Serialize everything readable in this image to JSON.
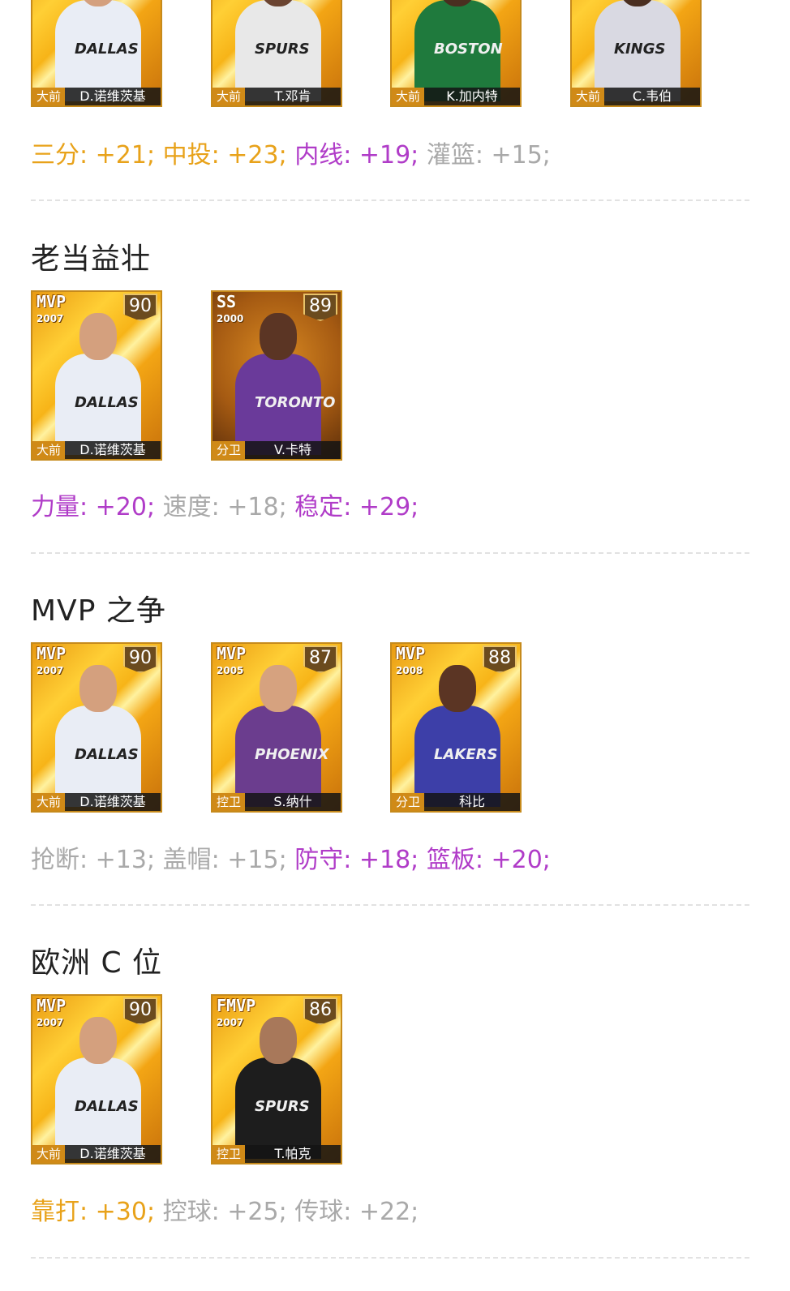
{
  "colors": {
    "gold": "#e8a21a",
    "purple": "#b03cc8",
    "gray": "#a9a9a9"
  },
  "sections": [
    {
      "title": "",
      "cards": [
        {
          "badge": "",
          "year": "",
          "rating": "",
          "pos": "大前",
          "name": "D.诺维茨基",
          "jersey": "DALLAS",
          "jersey_color": "#e9edf5",
          "skin": "#d4a07e"
        },
        {
          "badge": "",
          "year": "",
          "rating": "",
          "pos": "大前",
          "name": "T.邓肯",
          "jersey": "SPURS",
          "jersey_color": "#e8e8e8",
          "skin": "#6b4431"
        },
        {
          "badge": "",
          "year": "",
          "rating": "",
          "pos": "大前",
          "name": "K.加内特",
          "jersey": "BOSTON",
          "jersey_color": "#1f7a3d",
          "skin": "#4a2e20"
        },
        {
          "badge": "",
          "year": "",
          "rating": "",
          "pos": "大前",
          "name": "C.韦伯",
          "jersey": "KINGS",
          "jersey_color": "#d9d9e2",
          "skin": "#4a2e20"
        }
      ],
      "stats": [
        {
          "text": "三分: +21;",
          "color": "#e8a21a"
        },
        {
          "text": "中投: +23;",
          "color": "#e8a21a"
        },
        {
          "text": "内线: +19;",
          "color": "#b03cc8"
        },
        {
          "text": "灌篮: +15;",
          "color": "#a9a9a9"
        }
      ]
    },
    {
      "title": "老当益壮",
      "cards": [
        {
          "badge": "MVP",
          "year": "2007",
          "rating": "90",
          "pos": "大前",
          "name": "D.诺维茨基",
          "jersey": "DALLAS",
          "jersey_color": "#e9edf5",
          "skin": "#d4a07e"
        },
        {
          "badge": "SS",
          "year": "2000",
          "rating": "89",
          "pos": "分卫",
          "name": "V.卡特",
          "jersey": "TORONTO",
          "jersey_color": "#6a3a9a",
          "skin": "#5b3524",
          "dark": true
        }
      ],
      "stats": [
        {
          "text": "力量: +20;",
          "color": "#b03cc8"
        },
        {
          "text": "速度: +18;",
          "color": "#a9a9a9"
        },
        {
          "text": "稳定: +29;",
          "color": "#b03cc8"
        }
      ]
    },
    {
      "title": "MVP 之争",
      "cards": [
        {
          "badge": "MVP",
          "year": "2007",
          "rating": "90",
          "pos": "大前",
          "name": "D.诺维茨基",
          "jersey": "DALLAS",
          "jersey_color": "#e9edf5",
          "skin": "#d4a07e"
        },
        {
          "badge": "MVP",
          "year": "2005",
          "rating": "87",
          "pos": "控卫",
          "name": "S.纳什",
          "jersey": "PHOENIX",
          "jersey_color": "#6b3d8e",
          "skin": "#d6a27f"
        },
        {
          "badge": "MVP",
          "year": "2008",
          "rating": "88",
          "pos": "分卫",
          "name": "科比",
          "jersey": "LAKERS",
          "jersey_color": "#3d3fa8",
          "skin": "#5b3524"
        }
      ],
      "stats": [
        {
          "text": "抢断: +13;",
          "color": "#a9a9a9"
        },
        {
          "text": "盖帽: +15;",
          "color": "#a9a9a9"
        },
        {
          "text": "防守: +18;",
          "color": "#b03cc8"
        },
        {
          "text": "篮板: +20;",
          "color": "#b03cc8"
        }
      ]
    },
    {
      "title": "欧洲 C 位",
      "cards": [
        {
          "badge": "MVP",
          "year": "2007",
          "rating": "90",
          "pos": "大前",
          "name": "D.诺维茨基",
          "jersey": "DALLAS",
          "jersey_color": "#e9edf5",
          "skin": "#d4a07e"
        },
        {
          "badge": "FMVP",
          "year": "2007",
          "rating": "86",
          "pos": "控卫",
          "name": "T.帕克",
          "jersey": "SPURS",
          "jersey_color": "#1d1d1d",
          "skin": "#a8785a"
        }
      ],
      "stats": [
        {
          "text": "靠打: +30;",
          "color": "#e8a21a"
        },
        {
          "text": "控球: +25;",
          "color": "#a9a9a9"
        },
        {
          "text": "传球: +22;",
          "color": "#a9a9a9"
        }
      ]
    }
  ]
}
